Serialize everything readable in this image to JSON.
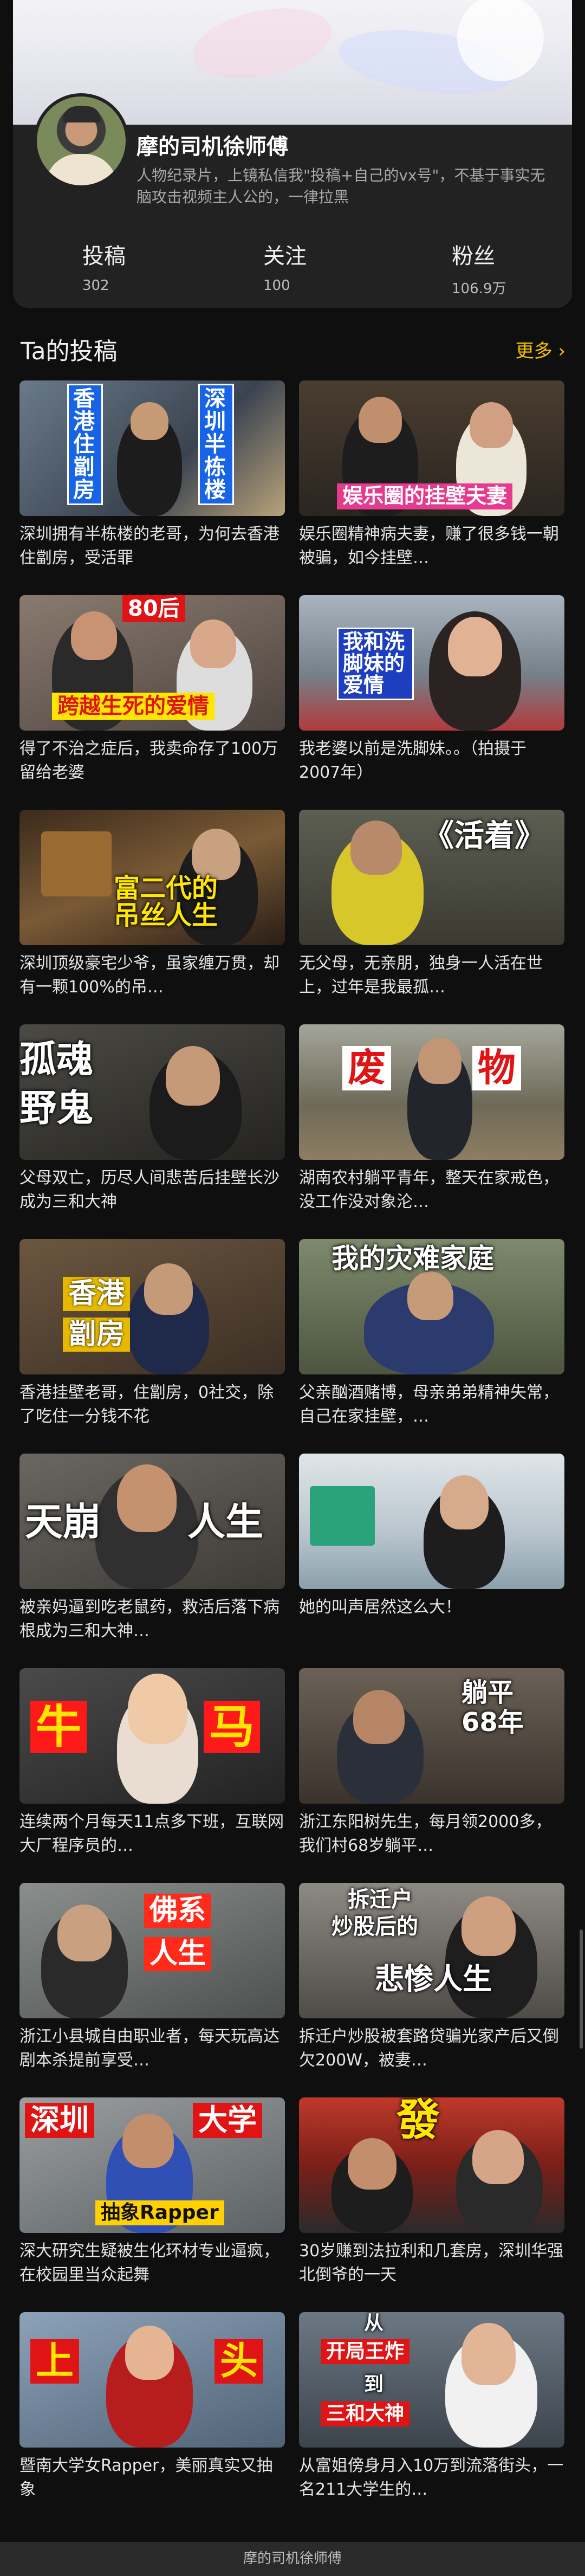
{
  "profile": {
    "name": "摩的司机徐师傅",
    "bio": "人物纪录片，上镜私信我\"投稿+自己的vx号\"，不基于事实无脑攻击视频主人公的，一律拉黑",
    "stats": [
      {
        "label": "投稿",
        "value": "302"
      },
      {
        "label": "关注",
        "value": "100"
      },
      {
        "label": "粉丝",
        "value": "106.9万"
      }
    ]
  },
  "section": {
    "title": "Ta的投稿",
    "more": "更多 ›"
  },
  "colors": {
    "accent": "#f3c200",
    "background": "#0f0f0f",
    "card": "#222222"
  },
  "videos": [
    {
      "caption": "深圳拥有半栋楼的老哥，为何去香港住劏房，受活罪",
      "overlays": [
        "香港住劏房",
        "深圳半栋楼"
      ]
    },
    {
      "caption": "娱乐圈精神病夫妻，赚了很多钱一朝被骗，如今挂壁…",
      "overlays": [
        "娱乐圈的挂壁夫妻"
      ]
    },
    {
      "caption": "得了不治之症后，我卖命存了100万留给老婆",
      "overlays": [
        "80后",
        "跨越生死的爱情"
      ]
    },
    {
      "caption": "我老婆以前是洗脚妹。。（拍摄于2007年）",
      "overlays": [
        "我和洗脚妹的爱情"
      ]
    },
    {
      "caption": "深圳顶级豪宅少爷，虽家缠万贯，却有一颗100%的吊…",
      "overlays": [
        "富二代的吊丝人生"
      ]
    },
    {
      "caption": "无父母，无亲朋，独身一人活在世上，过年是我最孤…",
      "overlays": [
        "《活着》"
      ]
    },
    {
      "caption": "父母双亡，历尽人间悲苦后挂壁长沙成为三和大神",
      "overlays": [
        "孤魂",
        "野鬼"
      ]
    },
    {
      "caption": "湖南农村躺平青年，整天在家戒色，没工作没对象沦…",
      "overlays": [
        "废",
        "物"
      ]
    },
    {
      "caption": "香港挂壁老哥，住劏房，0社交，除了吃住一分钱不花",
      "overlays": [
        "香港",
        "劏房"
      ]
    },
    {
      "caption": "父亲酗酒赌博，母亲弟弟精神失常，自己在家挂壁，…",
      "overlays": [
        "我的灾难家庭"
      ]
    },
    {
      "caption": "被亲妈逼到吃老鼠药，救活后落下病根成为三和大神…",
      "overlays": [
        "天崩",
        "人生"
      ]
    },
    {
      "caption": "她的叫声居然这么大！",
      "overlays": []
    },
    {
      "caption": "连续两个月每天11点多下班，互联网大厂程序员的…",
      "overlays": [
        "牛",
        "马"
      ]
    },
    {
      "caption": "浙江东阳树先生，每月领2000多，我们村68岁躺平…",
      "overlays": [
        "躺平",
        "68年"
      ]
    },
    {
      "caption": "浙江小县城自由职业者，每天玩高达剧本杀提前享受…",
      "overlays": [
        "佛系",
        "人生"
      ]
    },
    {
      "caption": "拆迁户炒股被套路贷骗光家产后又倒欠200W，被妻…",
      "overlays": [
        "拆迁户",
        "炒股后的",
        "悲惨人生"
      ]
    },
    {
      "caption": "深大研究生疑被生化环材专业逼疯，在校园里当众起舞",
      "overlays": [
        "深圳",
        "大学",
        "抽象Rapper"
      ]
    },
    {
      "caption": "30岁赚到法拉利和几套房，深圳华强北倒爷的一天",
      "overlays": [
        "發"
      ]
    },
    {
      "caption": "暨南大学女Rapper，美丽真实又抽象",
      "overlays": [
        "上",
        "头"
      ]
    },
    {
      "caption": "从富姐傍身月入10万到流落街头，一名211大学生的…",
      "overlays": [
        "从",
        "开局王炸",
        "到",
        "三和大神"
      ]
    }
  ],
  "footer": {
    "title": "摩的司机徐师傅"
  }
}
